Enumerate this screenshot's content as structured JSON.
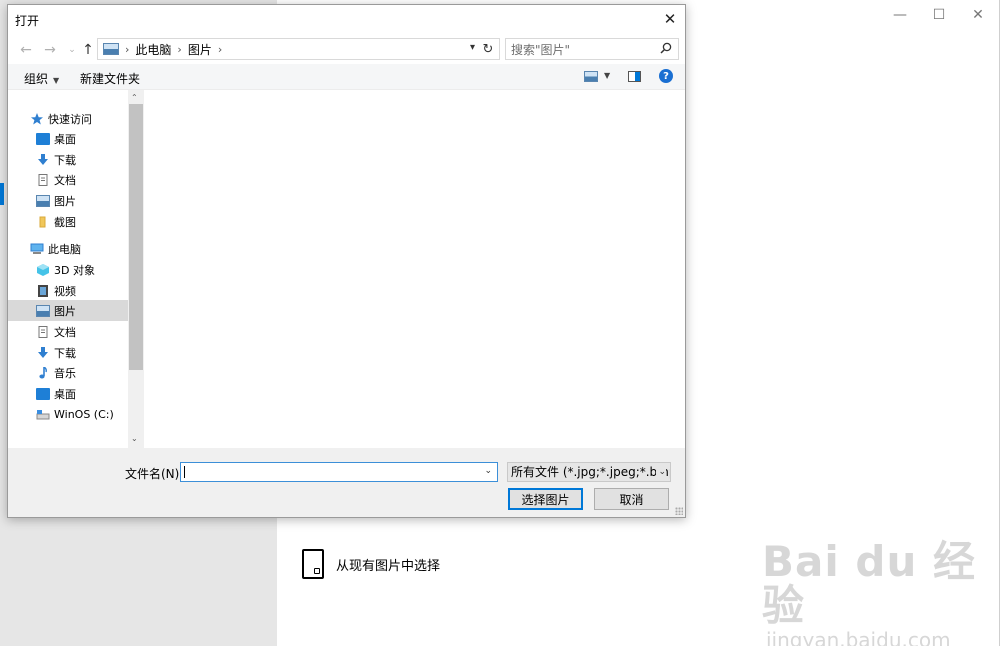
{
  "background": {
    "option_label": "从现有图片中选择",
    "watermark_main": "Bai du 经验",
    "watermark_sub": "jingyan.baidu.com"
  },
  "dialog": {
    "title": "打开",
    "breadcrumb": [
      "此电脑",
      "图片"
    ],
    "search_placeholder": "搜索\"图片\"",
    "toolbar": {
      "organize": "组织",
      "new_folder": "新建文件夹"
    },
    "nav": {
      "quick_access": "快速访问",
      "quick_items": [
        "桌面",
        "下载",
        "文档",
        "图片",
        "截图"
      ],
      "this_pc": "此电脑",
      "pc_items": [
        "3D 对象",
        "视频",
        "图片",
        "文档",
        "下载",
        "音乐",
        "桌面",
        "WinOS (C:)"
      ]
    },
    "filename_label": "文件名(N):",
    "filename_value": "",
    "filetype_selected": "所有文件 (*.jpg;*.jpeg;*.bmp;*",
    "open_button": "选择图片",
    "cancel_button": "取消"
  },
  "colors": {
    "accent": "#0078d7",
    "selected_row": "#d9d9d9",
    "sidebar_bg": "#e6e6e6"
  }
}
